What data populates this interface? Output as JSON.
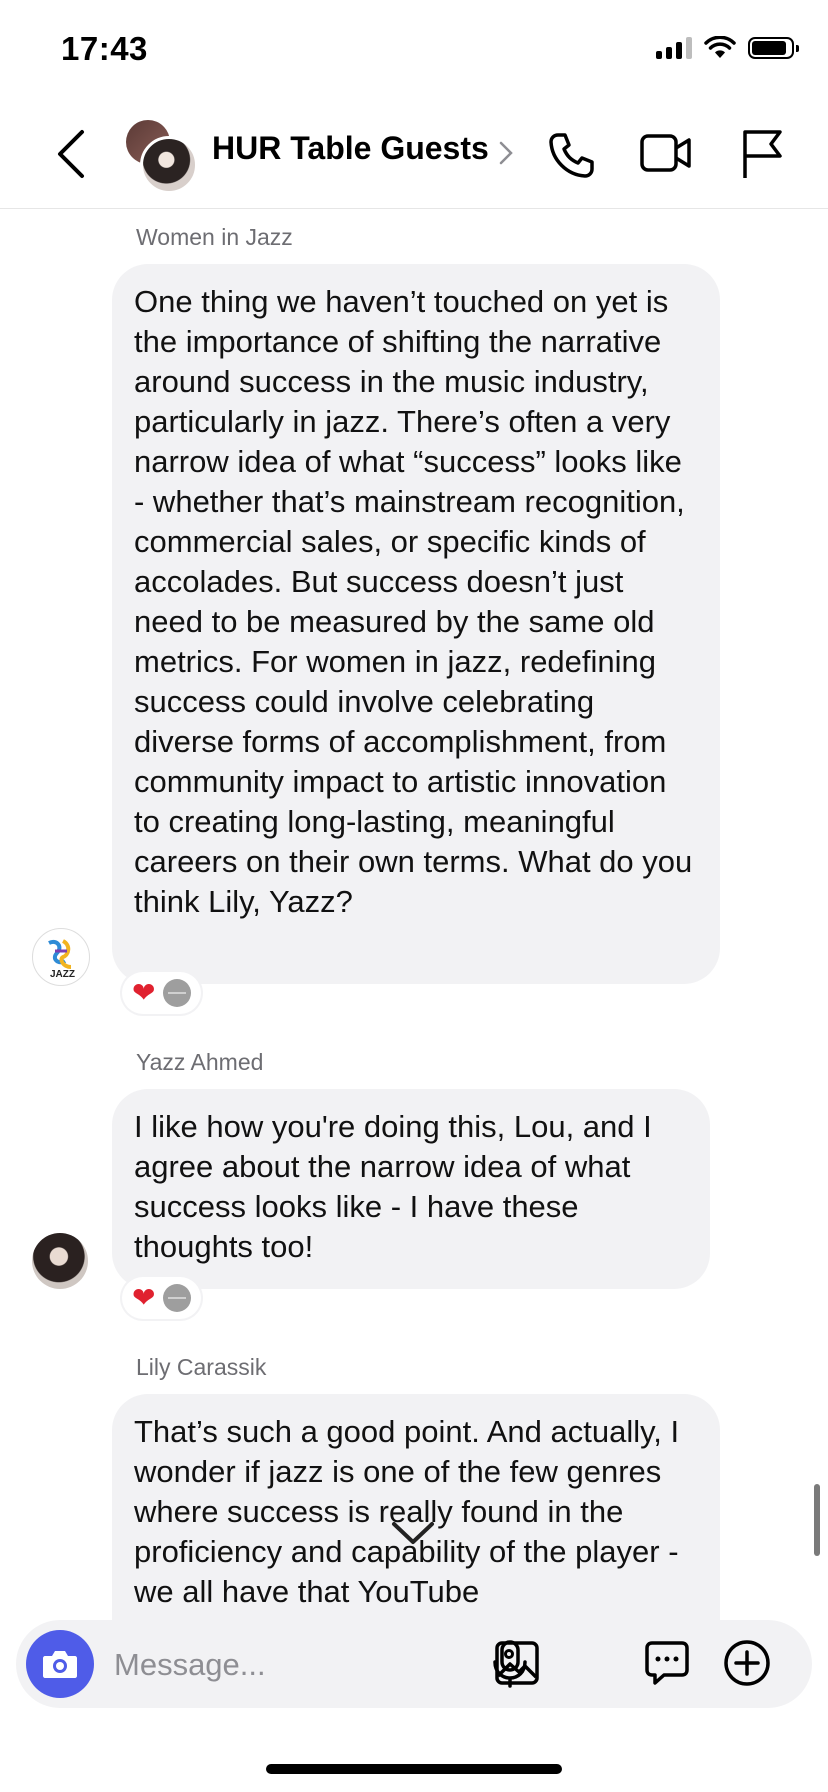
{
  "status_bar": {
    "time": "17:43"
  },
  "header": {
    "title": "HUR Table Guests"
  },
  "messages": [
    {
      "sender": "Women in Jazz",
      "text": "One thing we haven’t touched on yet is the importance of shifting the narrative around success in the music industry, particularly in jazz. There’s often a very narrow idea of what “success” looks like - whether that’s mainstream recognition, commercial sales, or specific kinds of accolades. But success doesn’t just need to be measured by the same old metrics. For women in jazz, redefining success could involve celebrating diverse forms of accomplishment, from community impact to artistic innovation to creating long-lasting, meaningful careers on their own terms. What do you think Lily, Yazz?",
      "reactions": [
        "heart",
        "neutral"
      ]
    },
    {
      "sender": "Yazz Ahmed",
      "text": "I like how you're doing this, Lou, and I agree about the narrow idea of what success looks like - I have these thoughts too!",
      "reactions": [
        "heart",
        "neutral"
      ]
    },
    {
      "sender": "Lily Carassik",
      "text": "That’s such a good point. And actually, I wonder if jazz is one of the few genres where success is really found in the proficiency and capability of the player - we all have that YouTube"
    }
  ],
  "composer": {
    "placeholder": "Message..."
  },
  "colors": {
    "accent": "#4f5ce8",
    "bubble": "#f2f2f4",
    "heart": "#e0212f"
  }
}
